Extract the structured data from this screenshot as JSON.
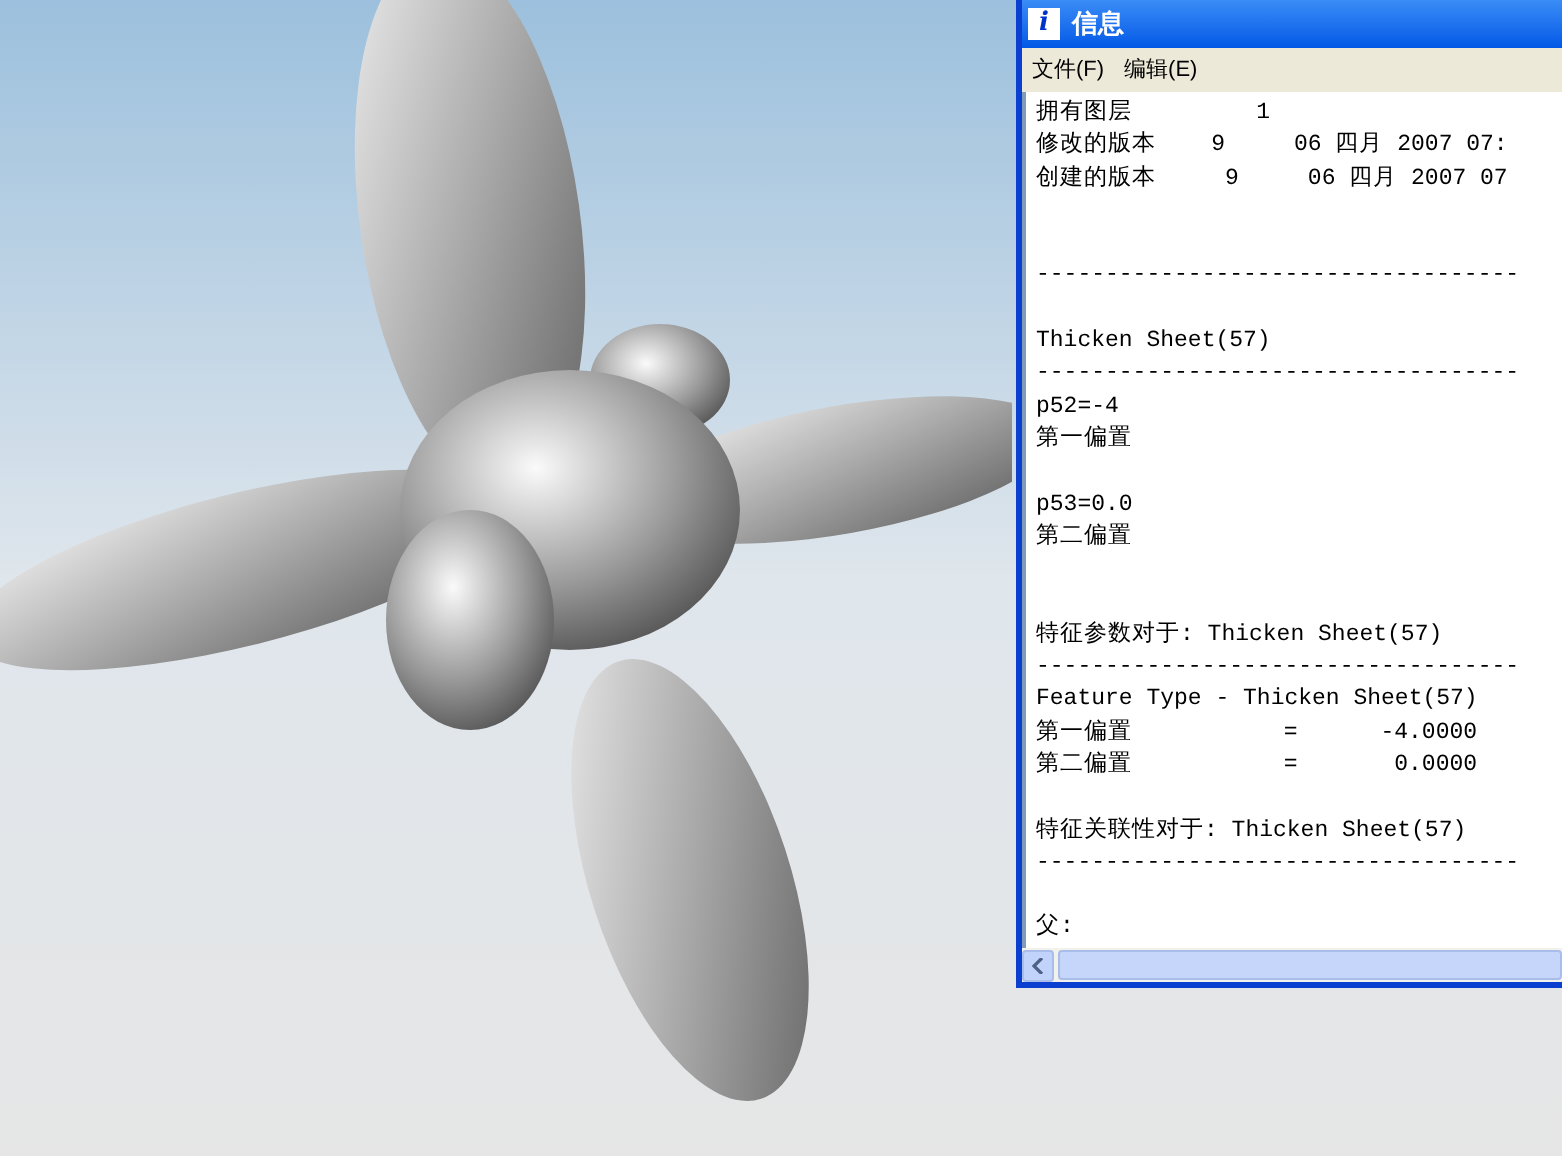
{
  "window": {
    "icon": "i",
    "title": "信息"
  },
  "menu": [
    {
      "label": "文件(F)"
    },
    {
      "label": "编辑(E)"
    }
  ],
  "lines": [
    {
      "kind": "line",
      "text": "拥有图层         1"
    },
    {
      "kind": "line",
      "text": "修改的版本    9     06 四月 2007 07:"
    },
    {
      "kind": "line",
      "text": "创建的版本     9     06 四月 2007 07"
    },
    {
      "kind": "gap"
    },
    {
      "kind": "gap"
    },
    {
      "kind": "line",
      "text": "-----------------------------------"
    },
    {
      "kind": "gap"
    },
    {
      "kind": "line",
      "text": "Thicken Sheet(57)"
    },
    {
      "kind": "line",
      "text": "-----------------------------------"
    },
    {
      "kind": "line",
      "text": "p52=-4"
    },
    {
      "kind": "line",
      "text": "第一偏置"
    },
    {
      "kind": "gap"
    },
    {
      "kind": "line",
      "text": "p53=0.0"
    },
    {
      "kind": "line",
      "text": "第二偏置"
    },
    {
      "kind": "gap"
    },
    {
      "kind": "gap"
    },
    {
      "kind": "line",
      "text": "特征参数对于: Thicken Sheet(57)"
    },
    {
      "kind": "line",
      "text": "-----------------------------------"
    },
    {
      "kind": "line",
      "text": "Feature Type - Thicken Sheet(57)"
    },
    {
      "kind": "line",
      "text": "第一偏置           =      -4.0000"
    },
    {
      "kind": "line",
      "text": "第二偏置           =       0.0000"
    },
    {
      "kind": "gap"
    },
    {
      "kind": "line",
      "text": "特征关联性对于: Thicken Sheet(57)"
    },
    {
      "kind": "line",
      "text": "-----------------------------------"
    },
    {
      "kind": "gap"
    },
    {
      "kind": "line",
      "text": "父:"
    }
  ]
}
